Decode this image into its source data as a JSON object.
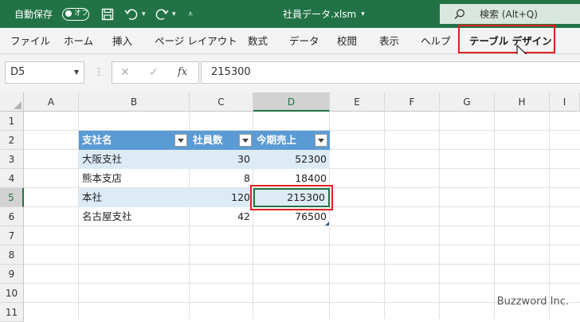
{
  "titlebar": {
    "autosave_label": "自動保存",
    "autosave_state": "オフ",
    "filename": "社員データ.xlsm",
    "search_label": "検索 (Alt+Q)"
  },
  "ribbon": {
    "tabs": [
      "ファイル",
      "ホーム",
      "挿入",
      "ページ レイアウト",
      "数式",
      "データ",
      "校閲",
      "表示",
      "ヘルプ",
      "テーブル デザイン"
    ]
  },
  "formula_bar": {
    "name_box": "D5",
    "cancel_glyph": "✕",
    "enter_glyph": "✓",
    "fx_label": "fx",
    "value": "215300"
  },
  "grid": {
    "columns": [
      "A",
      "B",
      "C",
      "D",
      "E",
      "F",
      "G",
      "H",
      "I"
    ],
    "rows": [
      "1",
      "2",
      "3",
      "4",
      "5",
      "6",
      "7",
      "8",
      "9",
      "10",
      "11"
    ],
    "selected_cell": "D5"
  },
  "table": {
    "headers": [
      "支社名",
      "社員数",
      "今期売上"
    ],
    "rows": [
      [
        "大阪支社",
        "30",
        "52300"
      ],
      [
        "熊本支店",
        "8",
        "18400"
      ],
      [
        "本社",
        "120",
        "215300"
      ],
      [
        "名古屋支社",
        "42",
        "76500"
      ]
    ]
  },
  "watermark": "Buzzword Inc.",
  "colors": {
    "title_green": "#217346",
    "table_header": "#5b9bd5",
    "table_band": "#ddebf7",
    "highlight_red": "#e02020"
  }
}
